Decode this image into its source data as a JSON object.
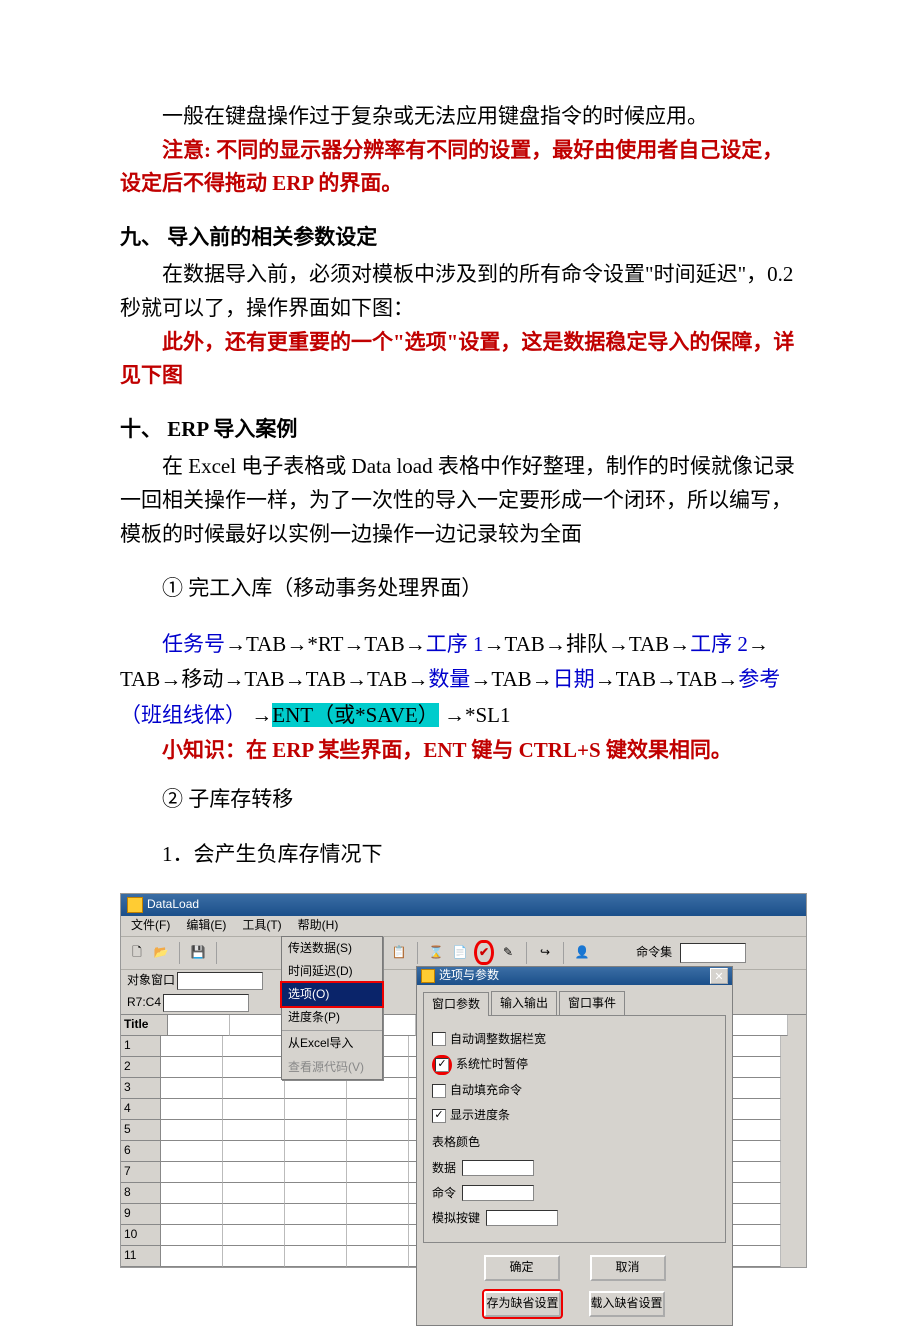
{
  "para1": "一般在键盘操作过于复杂或无法应用键盘指令的时候应用。",
  "para2a": "注意: 不同的显示器分辨率有不同的设置，最好由使用者自己设定，设定后不得拖动 ERP 的界面。",
  "h9": "九、  导入前的相关参数设定",
  "p91": "在数据导入前，必须对模板中涉及到的所有命令设置\"时间延迟\"，0.2 秒就可以了，操作界面如下图：",
  "p92": "此外，还有更重要的一个\"选项\"设置，这是数据稳定导入的保障，详见下图",
  "h10": "十、  ERP 导入案例",
  "p101": "在 Excel 电子表格或 Data load 表格中作好整理，制作的时候就像记录一回相关操作一样，为了一次性的导入一定要形成一个闭环，所以编写，模板的时候最好以实例一边操作一边记录较为全面",
  "step1": "① 完工入库（移动事务处理界面）",
  "seq": {
    "task": "任务号",
    "rt": "*RT",
    "op1": "工序 1",
    "queue": "排队",
    "op2": "工序 2",
    "move": "移动",
    "qty": "数量",
    "date": "日期",
    "ref": "参考（班组线体）",
    "ent": "ENT（或*SAVE）",
    "sl1": "*SL1",
    "tab": "TAB",
    "arrow": "→"
  },
  "tip": "小知识：在 ERP 某些界面，ENT 键与 CTRL+S 键效果相同。",
  "step2": "② 子库存转移",
  "step2_1": "1．会产生负库存情况下",
  "shot": {
    "title": "DataLoad",
    "menus": {
      "file": "文件(F)",
      "edit": "编辑(E)",
      "tools": "工具(T)",
      "help": "帮助(H)"
    },
    "cmdset": "命令集",
    "dropdown": {
      "send": "传送数据(S)",
      "delay": "时间延迟(D)",
      "options": "选项(O)",
      "progress": "进度条(P)",
      "excel": "从Excel导入",
      "viewsrc": "查看源代码(V)"
    },
    "leftlbl1": "对象窗口",
    "leftlbl2": "R7:C4",
    "gridTitle": "Title",
    "gridRows": [
      "1",
      "2",
      "3",
      "4",
      "5",
      "6",
      "7",
      "8",
      "9",
      "10",
      "11"
    ],
    "dialog": {
      "title": "选项与参数",
      "tabs": [
        "窗口参数",
        "输入输出",
        "窗口事件"
      ],
      "chk1": "自动调整数据栏宽",
      "chk2": "系统忙时暂停",
      "chk3": "自动填充命令",
      "chk4": "显示进度条",
      "grp": "表格颜色",
      "f1": "数据",
      "f2": "命令",
      "f3": "模拟按键",
      "ok": "确定",
      "cancel": "取消",
      "save": "存为缺省设置",
      "load": "载入缺省设置"
    }
  }
}
